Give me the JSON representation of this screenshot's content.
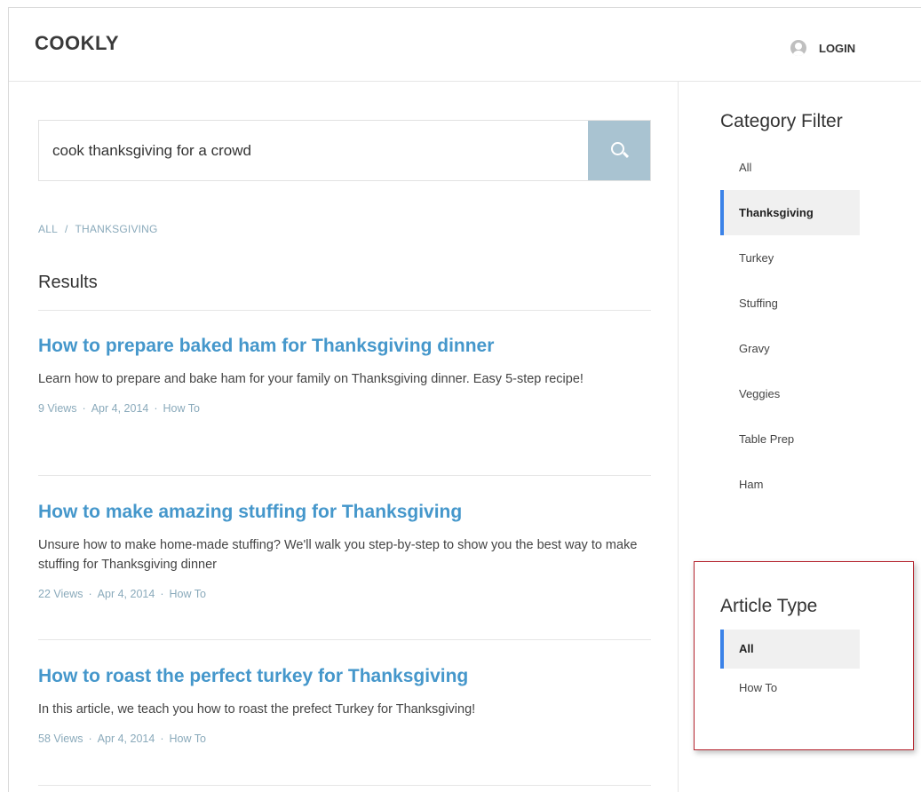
{
  "header": {
    "logo": "COOKLY",
    "login_label": "LOGIN"
  },
  "search": {
    "value": "cook thanksgiving for a crowd"
  },
  "breadcrumb": {
    "items": [
      "ALL",
      "THANKSGIVING"
    ],
    "separator": "/"
  },
  "results": {
    "heading": "Results",
    "items": [
      {
        "title": "How to prepare baked ham for Thanksgiving dinner",
        "description": "Learn how to prepare and bake ham for your family on Thanksgiving dinner. Easy 5-step recipe!",
        "views": "9 Views",
        "date": "Apr 4, 2014",
        "type": "How To"
      },
      {
        "title": "How to make amazing stuffing for Thanksgiving",
        "description": "Unsure how to make home-made stuffing? We'll walk you step-by-step to show you the best way to make stuffing for Thanksgiving dinner",
        "views": "22 Views",
        "date": "Apr 4, 2014",
        "type": "How To"
      },
      {
        "title": "How to roast the perfect turkey for Thanksgiving",
        "description": "In this article, we teach you how to roast the prefect Turkey for Thanksgiving!",
        "views": "58 Views",
        "date": "Apr 4, 2014",
        "type": "How To"
      }
    ],
    "meta_separator": "·"
  },
  "category_filter": {
    "title": "Category Filter",
    "items": [
      "All",
      "Thanksgiving",
      "Turkey",
      "Stuffing",
      "Gravy",
      "Veggies",
      "Table Prep",
      "Ham"
    ],
    "selected": "Thanksgiving"
  },
  "article_type": {
    "title": "Article Type",
    "items": [
      "All",
      "How To"
    ],
    "selected": "All"
  },
  "colors": {
    "accent": "#3b82e8",
    "link": "#4597cb",
    "search_button": "#a9c3d1",
    "highlight_border": "#b5242e"
  },
  "icons": {
    "login": "user-circle-icon",
    "search": "search-icon"
  }
}
